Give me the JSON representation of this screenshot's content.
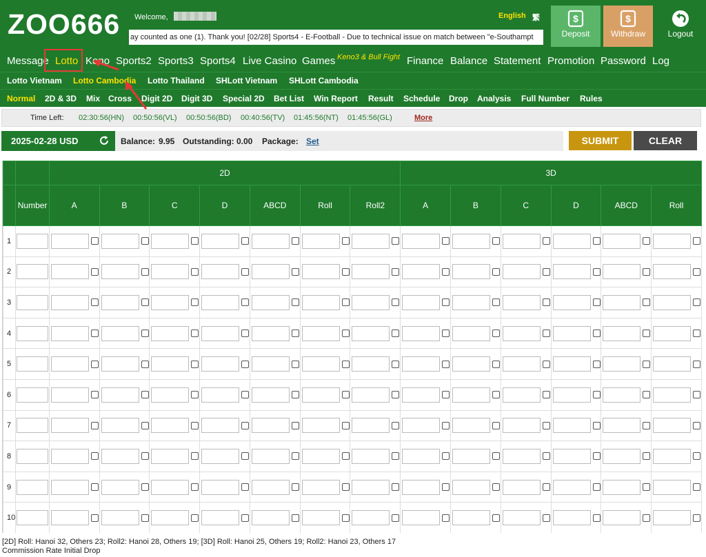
{
  "header": {
    "logo": "ZOO666",
    "welcome": "Welcome,",
    "marquee": "ay counted as one (1). Thank you!       [02/28] Sports4 - E-Football - Due to technical issue on match between \"e-Southampt",
    "language": "English",
    "lang_icon": "繁",
    "buttons": {
      "deposit": "Deposit",
      "withdraw": "Withdraw",
      "logout": "Logout"
    }
  },
  "mainnav": [
    "Message",
    "Lotto",
    "Keno",
    "Sports2",
    "Sports3",
    "Sports4",
    "Live Casino",
    "Games",
    "Finance",
    "Balance",
    "Statement",
    "Promotion",
    "Password",
    "Log"
  ],
  "mainnav_sup": "Keno3 & Bull Fight",
  "mainnav_active": "Lotto",
  "subnav": [
    "Lotto Vietnam",
    "Lotto Cambodia",
    "Lotto Thailand",
    "SHLott Vietnam",
    "SHLott Cambodia"
  ],
  "subnav_active": "Lotto Cambodia",
  "tabs": [
    "Normal",
    "2D & 3D",
    "Mix",
    "Cross",
    "Digit 2D",
    "Digit 3D",
    "Special 2D",
    "Bet List",
    "Win Report",
    "Result",
    "Schedule",
    "Drop",
    "Analysis",
    "Full Number",
    "Rules"
  ],
  "tabs_active": "Normal",
  "timeleft": {
    "label": "Time Left:",
    "times": [
      "02:30:56(HN)",
      "00:50:56(VL)",
      "00:50:56(BD)",
      "00:40:56(TV)",
      "01:45:56(NT)",
      "01:45:56(GL)"
    ],
    "more": "More"
  },
  "info": {
    "date": "2025-02-28 USD",
    "balance_label": "Balance:",
    "balance": "9.95",
    "outstanding_label": "Outstanding:",
    "outstanding": "0.00",
    "package_label": "Package:",
    "package_link": "Set",
    "submit": "SUBMIT",
    "clear": "CLEAR"
  },
  "table": {
    "group_2d": "2D",
    "group_3d": "3D",
    "number_header": "Number",
    "cols_2d": [
      "A",
      "B",
      "C",
      "D",
      "ABCD",
      "Roll",
      "Roll2"
    ],
    "cols_3d": [
      "A",
      "B",
      "C",
      "D",
      "ABCD",
      "Roll"
    ],
    "rows": [
      "1",
      "2",
      "3",
      "4",
      "5",
      "6",
      "7",
      "8",
      "9",
      "10"
    ]
  },
  "footnote": {
    "line1": "[2D] Roll: Hanoi 32, Others 23; Roll2: Hanoi 28, Others 19; [3D] Roll: Hanoi 25, Others 19; Roll2: Hanoi 23, Others 17",
    "line2": "Commission Rate Initial Drop"
  },
  "colors": {
    "brand_green": "#1f7a2c",
    "active_yellow": "#ffe100",
    "submit": "#c8960e",
    "clear": "#4a4a4a",
    "annotation_red": "#e53935"
  }
}
